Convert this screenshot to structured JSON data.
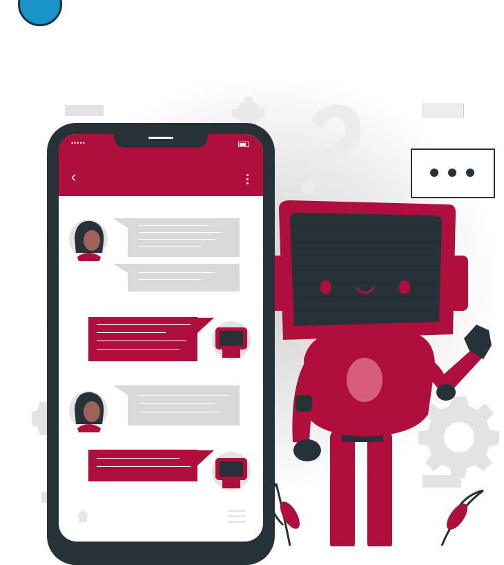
{
  "phone": {
    "status_signal": "••••• ",
    "back_icon": "chevron-left-icon",
    "menu_icon": "more-vertical-icon",
    "home_icon": "home-icon",
    "hamburger_icon": "menu-icon"
  },
  "robot": {
    "thought_icon": "question-mark-icon",
    "speech_icon": "typing-dots-icon"
  },
  "colors": {
    "accent": "#ae0f3c",
    "dark": "#263238",
    "bubble_gray": "#d9d9d9",
    "badge_blue": "#1a93c6"
  }
}
